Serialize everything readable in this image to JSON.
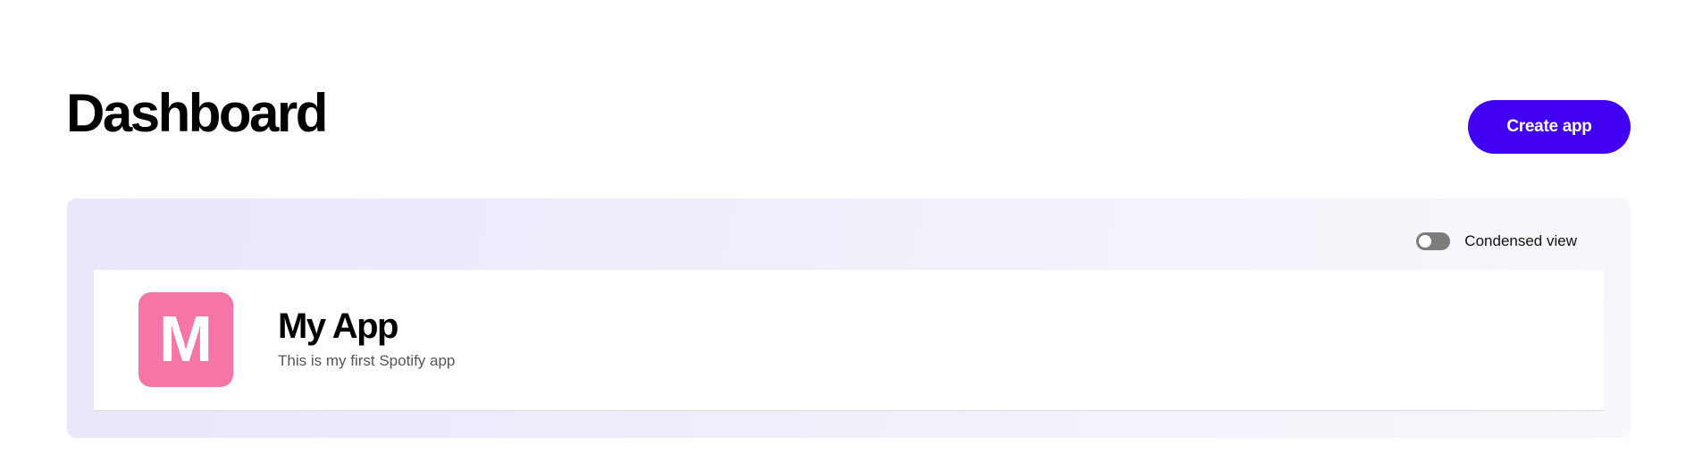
{
  "header": {
    "title": "Dashboard",
    "create_button_label": "Create app"
  },
  "view_toggle": {
    "label": "Condensed view",
    "enabled": false
  },
  "apps": [
    {
      "avatar_letter": "M",
      "name": "My App",
      "description": "This is my first Spotify app"
    }
  ],
  "colors": {
    "accent": "#4100f4",
    "avatar_bg": "#f576a6",
    "toggle_off": "#7c7c7c"
  }
}
